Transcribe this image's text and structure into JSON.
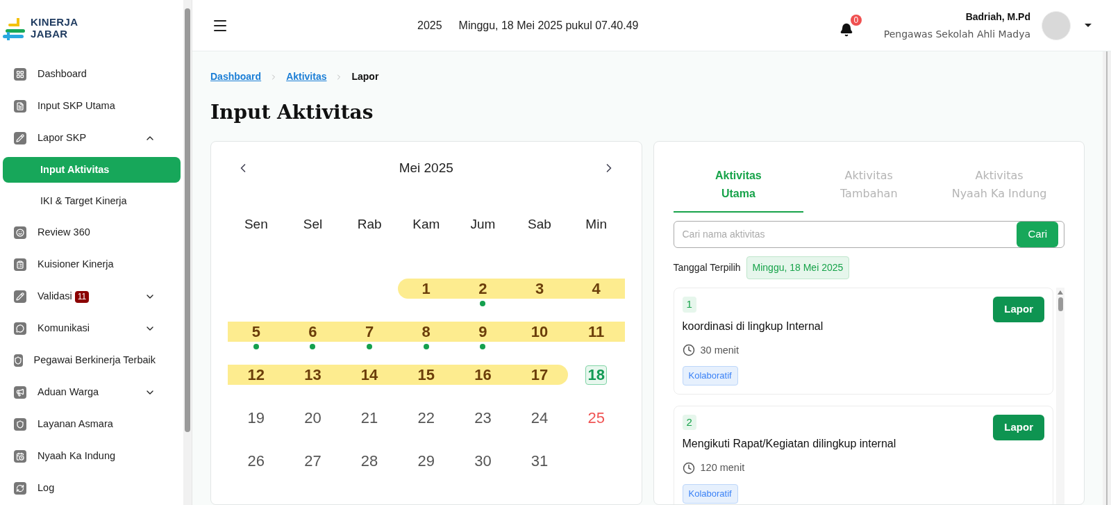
{
  "logo": {
    "line_1": "KINERJA",
    "line_2": "JABAR"
  },
  "sidebar": {
    "items": [
      {
        "label": "Dashboard"
      },
      {
        "label": "Input SKP Utama"
      },
      {
        "label": "Lapor SKP",
        "expanded": true,
        "children": [
          {
            "label": "Input Aktivitas",
            "selected": true
          },
          {
            "label": "IKI & Target Kinerja",
            "selected": false
          }
        ]
      },
      {
        "label": "Review 360"
      },
      {
        "label": "Kuisioner Kinerja"
      },
      {
        "label": "Validasi",
        "badge": "11",
        "expanded": false
      },
      {
        "label": "Komunikasi",
        "expanded": false
      },
      {
        "label": "Pegawai Berkinerja Terbaik"
      },
      {
        "label": "Aduan Warga",
        "expanded": false
      },
      {
        "label": "Layanan Asmara"
      },
      {
        "label": "Nyaah Ka Indung"
      },
      {
        "label": "Log"
      }
    ]
  },
  "header": {
    "year": "2025",
    "datetime": "Minggu, 18 Mei 2025 pukul 07.40.49",
    "notifications": "0",
    "user_name": "Badriah, M.Pd",
    "user_role": "Pengawas Sekolah Ahli Madya"
  },
  "breadcrumbs": [
    {
      "label": "Dashboard",
      "kind": "link"
    },
    {
      "label": "Aktivitas",
      "kind": "link"
    },
    {
      "label": "Lapor",
      "kind": "current"
    }
  ],
  "page_title": "Input Aktivitas",
  "calendar": {
    "month": "Mei 2025",
    "weekdays": [
      "Sen",
      "Sel",
      "Rab",
      "Kam",
      "Jum",
      "Sab",
      "Min"
    ],
    "weeks": [
      [
        {
          "kind": "blank"
        },
        {
          "kind": "blank"
        },
        {
          "kind": "blank"
        },
        {
          "kind": "day",
          "text": "1",
          "highlighted": true,
          "dot": false,
          "selected": false,
          "holiday": false
        },
        {
          "kind": "day",
          "text": "2",
          "highlighted": true,
          "dot": true,
          "selected": false,
          "holiday": false
        },
        {
          "kind": "day",
          "text": "3",
          "highlighted": true,
          "dot": false,
          "selected": false,
          "holiday": false
        },
        {
          "kind": "day",
          "text": "4",
          "highlighted": true,
          "dot": false,
          "selected": false,
          "holiday": false
        }
      ],
      [
        {
          "kind": "day",
          "text": "5",
          "highlighted": true,
          "dot": true,
          "selected": false,
          "holiday": false
        },
        {
          "kind": "day",
          "text": "6",
          "highlighted": true,
          "dot": true,
          "selected": false,
          "holiday": false
        },
        {
          "kind": "day",
          "text": "7",
          "highlighted": true,
          "dot": true,
          "selected": false,
          "holiday": false
        },
        {
          "kind": "day",
          "text": "8",
          "highlighted": true,
          "dot": true,
          "selected": false,
          "holiday": false
        },
        {
          "kind": "day",
          "text": "9",
          "highlighted": true,
          "dot": true,
          "selected": false,
          "holiday": false
        },
        {
          "kind": "day",
          "text": "10",
          "highlighted": true,
          "dot": false,
          "selected": false,
          "holiday": false
        },
        {
          "kind": "day",
          "text": "11",
          "highlighted": true,
          "dot": false,
          "selected": false,
          "holiday": false
        }
      ],
      [
        {
          "kind": "day",
          "text": "12",
          "highlighted": true,
          "dot": false,
          "selected": false,
          "holiday": false
        },
        {
          "kind": "day",
          "text": "13",
          "highlighted": true,
          "dot": false,
          "selected": false,
          "holiday": false
        },
        {
          "kind": "day",
          "text": "14",
          "highlighted": true,
          "dot": false,
          "selected": false,
          "holiday": false
        },
        {
          "kind": "day",
          "text": "15",
          "highlighted": true,
          "dot": false,
          "selected": false,
          "holiday": false
        },
        {
          "kind": "day",
          "text": "16",
          "highlighted": true,
          "dot": false,
          "selected": false,
          "holiday": false
        },
        {
          "kind": "day",
          "text": "17",
          "highlighted": true,
          "dot": false,
          "selected": false,
          "holiday": false
        },
        {
          "kind": "day",
          "text": "18",
          "highlighted": false,
          "dot": false,
          "selected": true,
          "holiday": false
        }
      ],
      [
        {
          "kind": "day",
          "text": "19",
          "highlighted": false,
          "dot": false,
          "selected": false,
          "holiday": false
        },
        {
          "kind": "day",
          "text": "20",
          "highlighted": false,
          "dot": false,
          "selected": false,
          "holiday": false
        },
        {
          "kind": "day",
          "text": "21",
          "highlighted": false,
          "dot": false,
          "selected": false,
          "holiday": false
        },
        {
          "kind": "day",
          "text": "22",
          "highlighted": false,
          "dot": false,
          "selected": false,
          "holiday": false
        },
        {
          "kind": "day",
          "text": "23",
          "highlighted": false,
          "dot": false,
          "selected": false,
          "holiday": false
        },
        {
          "kind": "day",
          "text": "24",
          "highlighted": false,
          "dot": false,
          "selected": false,
          "holiday": false
        },
        {
          "kind": "day",
          "text": "25",
          "highlighted": false,
          "dot": false,
          "selected": false,
          "holiday": true
        }
      ],
      [
        {
          "kind": "day",
          "text": "26",
          "highlighted": false,
          "dot": false,
          "selected": false,
          "holiday": false
        },
        {
          "kind": "day",
          "text": "27",
          "highlighted": false,
          "dot": false,
          "selected": false,
          "holiday": false
        },
        {
          "kind": "day",
          "text": "28",
          "highlighted": false,
          "dot": false,
          "selected": false,
          "holiday": false
        },
        {
          "kind": "day",
          "text": "29",
          "highlighted": false,
          "dot": false,
          "selected": false,
          "holiday": false
        },
        {
          "kind": "day",
          "text": "30",
          "highlighted": false,
          "dot": false,
          "selected": false,
          "holiday": false
        },
        {
          "kind": "day",
          "text": "31",
          "highlighted": false,
          "dot": false,
          "selected": false,
          "holiday": false
        },
        {
          "kind": "blank"
        }
      ]
    ]
  },
  "tabs": [
    {
      "line_1": "Aktivitas",
      "line_2": "Utama",
      "selected": true
    },
    {
      "line_1": "Aktivitas",
      "line_2": "Tambahan",
      "selected": false
    },
    {
      "line_1": "Aktivitas",
      "line_2": "Nyaah Ka Indung",
      "selected": false
    }
  ],
  "search": {
    "placeholder": "Cari nama aktivitas",
    "button": "Cari"
  },
  "selected_date": {
    "label": "Tanggal Terpilih",
    "value": "Minggu, 18 Mei 2025"
  },
  "activities": [
    {
      "number": "1",
      "title": "koordinasi di lingkup Internal",
      "duration": "30 menit",
      "tag": "Kolaboratif",
      "button": "Lapor"
    },
    {
      "number": "2",
      "title": "Mengikuti Rapat/Kegiatan dilingkup internal",
      "duration": "120 menit",
      "tag": "Kolaboratif",
      "button": "Lapor"
    }
  ]
}
